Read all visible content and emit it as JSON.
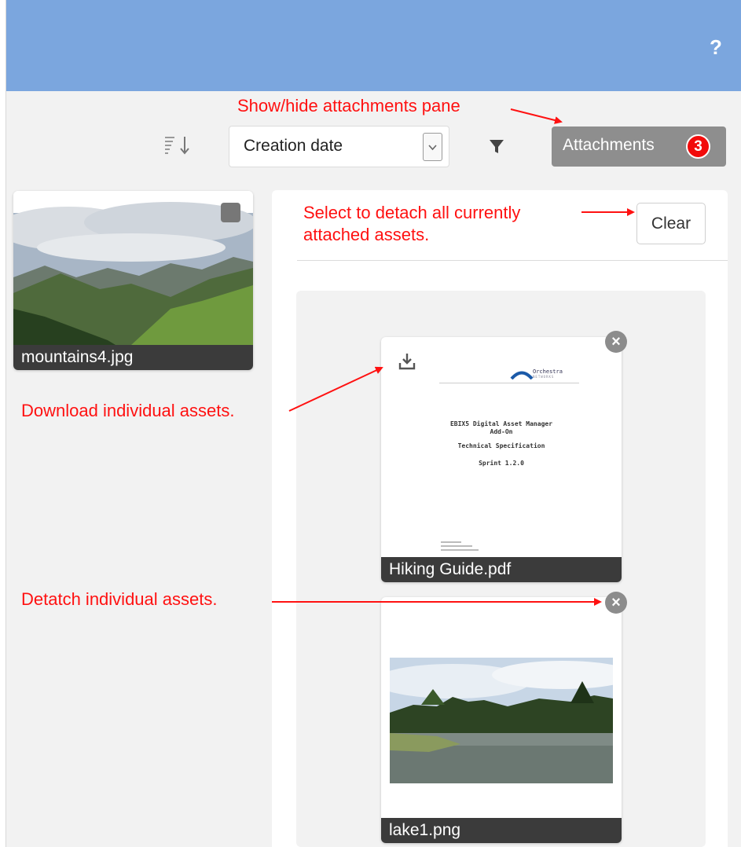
{
  "header": {
    "help_label": "?"
  },
  "toolbar": {
    "sort_value": "Creation date",
    "attachments_label": "Attachments",
    "attachments_count": "3"
  },
  "library": {
    "items": [
      {
        "name": "mountains4.jpg"
      }
    ]
  },
  "attachments_pane": {
    "clear_label": "Clear",
    "items": [
      {
        "name": "Hiking Guide.pdf",
        "preview": {
          "logo_text": "Orchestra",
          "logo_sub": "NETWORKS",
          "title_line1": "EBIX5 Digital Asset Manager",
          "title_line2": "Add-On",
          "title_line3": "Technical Specification",
          "title_line4": "Sprint 1.2.0"
        }
      },
      {
        "name": "lake1.png"
      }
    ]
  },
  "annotations": {
    "show_hide": "Show/hide attachments pane",
    "select_detach_line1": "Select to detach all currently",
    "select_detach_line2": "attached assets.",
    "download": "Download individual assets.",
    "detach": "Detatch individual assets."
  },
  "colors": {
    "header": "#7ba6de",
    "annotation": "#ff1111",
    "badge": "#f20b0b",
    "attachments_button": "#8e8e8e"
  }
}
